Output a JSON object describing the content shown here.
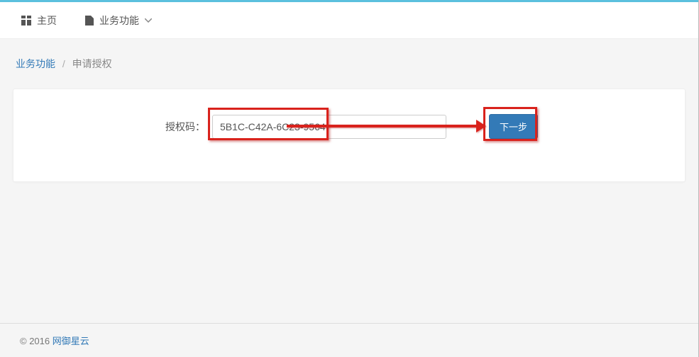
{
  "nav": {
    "home_label": "主页",
    "biz_label": "业务功能"
  },
  "breadcrumb": {
    "parent": "业务功能",
    "separator": "/",
    "current": "申请授权"
  },
  "form": {
    "label": "授权码：",
    "value": "5B1C-C42A-6C23-9564",
    "submit_label": "下一步"
  },
  "footer": {
    "copyright": "© 2016 ",
    "link": "网御星云"
  }
}
